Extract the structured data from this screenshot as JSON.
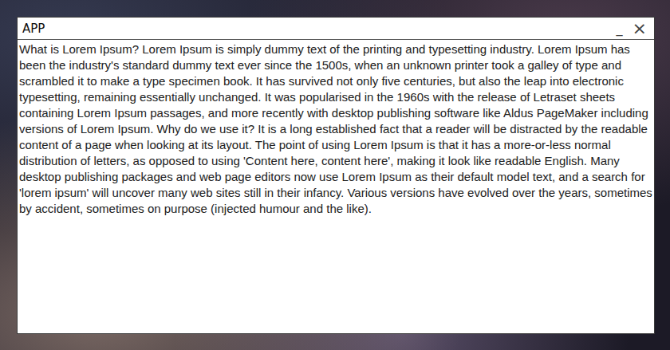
{
  "window": {
    "title": "APP",
    "minimize": "_",
    "close": "×"
  },
  "content": "What is Lorem Ipsum? Lorem Ipsum is simply dummy text of the printing and typesetting industry. Lorem Ipsum has been the industry's standard dummy text ever since the 1500s, when an unknown printer took a galley of type and scrambled it to make a type specimen book. It has survived not only five centuries, but also the leap into electronic typesetting, remaining essentially unchanged. It was popularised in the 1960s with the release of Letraset sheets containing Lorem Ipsum passages, and more recently with desktop publishing software like Aldus PageMaker including versions of Lorem Ipsum. Why do we use it? It is a long established fact that a reader will be distracted by the readable content of a page when looking at its layout. The point of using Lorem Ipsum is that it has a more-or-less normal distribution of letters, as opposed to using 'Content here, content here', making it look like readable English. Many desktop publishing packages and web page editors now use Lorem Ipsum as their default model text, and a search for 'lorem ipsum' will uncover many web sites still in their infancy. Various versions have evolved over the years, sometimes by accident, sometimes on purpose (injected humour and the like)."
}
